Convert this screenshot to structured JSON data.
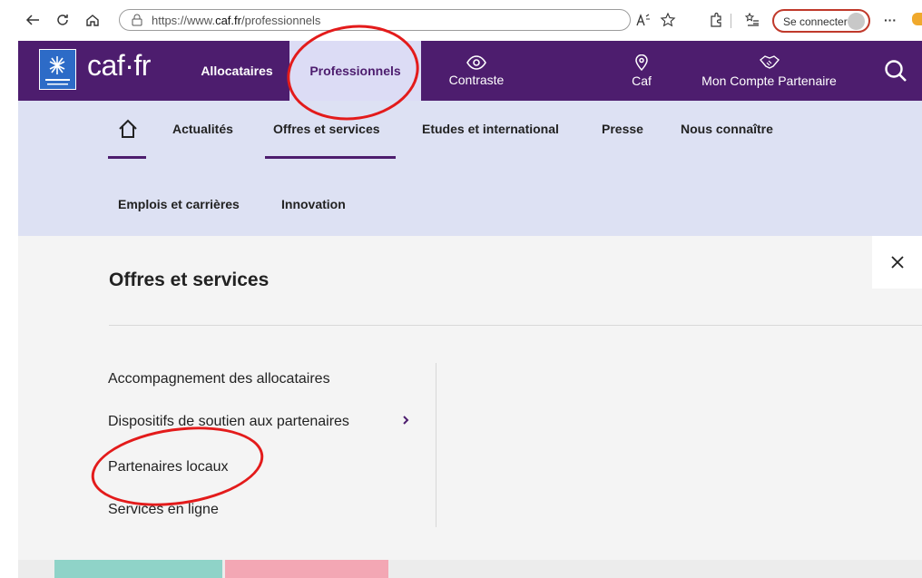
{
  "browser": {
    "url_prefix": "https://www.",
    "url_domain": "caf.fr",
    "url_path": "/professionnels",
    "signin_label": "Se connecter",
    "more_label": "···"
  },
  "header": {
    "logo_text": "caf·fr",
    "tabs": [
      {
        "label": "Allocataires"
      },
      {
        "label": "Professionnels"
      }
    ],
    "links": {
      "contrast": "Contraste",
      "caf": "Caf",
      "partner": "Mon Compte Partenaire"
    }
  },
  "subnav": {
    "items": [
      "Actualités",
      "Offres et services",
      "Etudes et international",
      "Presse",
      "Nous connaître",
      "Emplois et carrières",
      "Innovation"
    ]
  },
  "panel": {
    "title": "Offres et services",
    "items": [
      "Accompagnement des allocataires",
      "Dispositifs de soutien aux partenaires",
      "Partenaires locaux",
      "Services en ligne"
    ]
  },
  "colors": {
    "header_bg": "#4d1d6e",
    "subnav_bg": "#dde1f3",
    "active_tab_bg": "#dcdcf5",
    "annotation": "#e31b1b"
  }
}
